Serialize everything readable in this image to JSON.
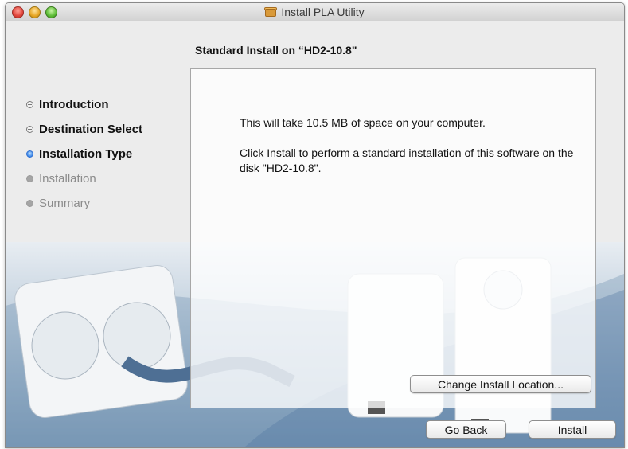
{
  "window": {
    "title": "Install PLA Utility"
  },
  "heading": "Standard Install on “HD2-10.8\"",
  "steps": [
    {
      "label": "Introduction",
      "state": "done"
    },
    {
      "label": "Destination Select",
      "state": "done"
    },
    {
      "label": "Installation Type",
      "state": "current"
    },
    {
      "label": "Installation",
      "state": "pending"
    },
    {
      "label": "Summary",
      "state": "pending"
    }
  ],
  "content": {
    "space_message": "This will take 10.5 MB of space on your computer.",
    "install_message": "Click Install to perform a standard installation of this software on the disk \"HD2-10.8\"."
  },
  "buttons": {
    "change_location": "Change Install Location...",
    "go_back": "Go Back",
    "install": "Install"
  },
  "icons": {
    "title_icon": "package-icon",
    "close": "close-window-icon",
    "minimize": "minimize-window-icon",
    "zoom": "zoom-window-icon"
  },
  "colors": {
    "current_step_bullet": "#3a86e8",
    "close": "#e0443a",
    "minimize": "#e6a524",
    "zoom": "#5cbc36"
  }
}
